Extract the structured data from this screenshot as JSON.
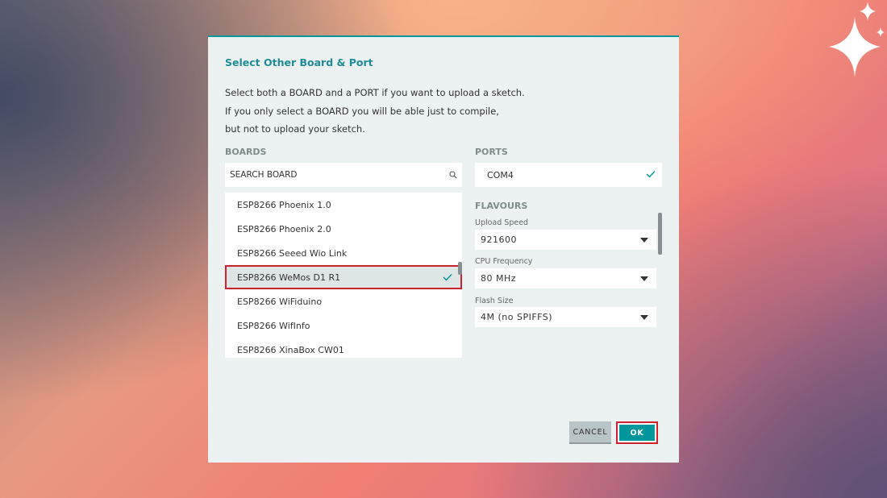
{
  "dialog": {
    "title": "Select Other Board & Port",
    "description": [
      "Select both a BOARD and a PORT if you want to upload a sketch.",
      "If you only select a BOARD you will be able just to compile,",
      "but not to upload your sketch."
    ]
  },
  "boards": {
    "label": "BOARDS",
    "search_placeholder": "SEARCH BOARD",
    "items": [
      {
        "label": "ESP8266 Phoenix 1.0",
        "selected": false
      },
      {
        "label": "ESP8266 Phoenix 2.0",
        "selected": false
      },
      {
        "label": "ESP8266 Seeed Wio Link",
        "selected": false
      },
      {
        "label": "ESP8266 WeMos D1 R1",
        "selected": true
      },
      {
        "label": "ESP8266 WiFiduino",
        "selected": false
      },
      {
        "label": "ESP8266 WifInfo",
        "selected": false
      },
      {
        "label": "ESP8266 XinaBox CW01",
        "selected": false
      }
    ]
  },
  "ports": {
    "label": "PORTS",
    "selected": "COM4"
  },
  "flavours": {
    "label": "FLAVOURS",
    "upload_speed": {
      "label": "Upload Speed",
      "value": "921600"
    },
    "cpu_frequency": {
      "label": "CPU Frequency",
      "value": "80 MHz"
    },
    "flash_size": {
      "label": "Flash Size",
      "value": "4M (no SPIFFS)"
    }
  },
  "buttons": {
    "cancel": "CANCEL",
    "ok": "OK"
  },
  "colors": {
    "accent": "#00979c",
    "title": "#1e8d97",
    "highlight": "#d01f2e"
  }
}
